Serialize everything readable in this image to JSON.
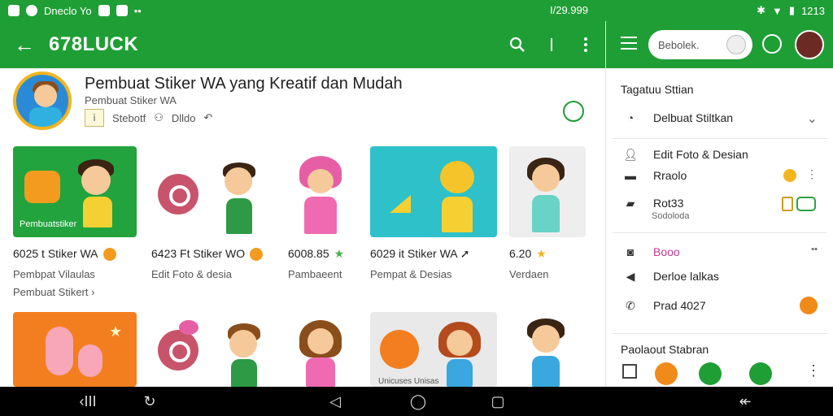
{
  "status_bar": {
    "left_text": "Dneclo Yo",
    "mid_text": "I/29.999",
    "time": "1213"
  },
  "app_bar": {
    "title": "678LUCK"
  },
  "app_info": {
    "title": "Pembuat Stiker WA yang Kreatif dan Mudah",
    "subtitle": "Pembuat Stiker  WA",
    "meta_1": "Stebotf",
    "meta_2": "Dlldo"
  },
  "grid": {
    "row1": [
      {
        "thumb_text": "Pembuatstiker",
        "title": "6025 t Stiker WA",
        "sub1": "Pembpat Vilaulas",
        "sub2": "Pembuat Stikert"
      },
      {
        "title": "6423 Ft Stiker WO",
        "sub1": "Edit Foto & desia"
      },
      {
        "title": "6008.85",
        "sub1": "Pambaeent"
      },
      {
        "title": "6029 it Stiker WA",
        "sub1": "Pempat & Desias"
      },
      {
        "title": "6.20",
        "sub1": "Verdaen"
      }
    ],
    "row2": [
      {
        "thumb_text": "",
        "title": ""
      },
      {
        "thumb_text": "",
        "title": ""
      },
      {
        "thumb_text": "",
        "title": ""
      },
      {
        "thumb_text": "Unicuses Unisas",
        "title": ""
      },
      {
        "thumb_text": "",
        "title": ""
      }
    ]
  },
  "drawer": {
    "search_text": "Bebolek.",
    "section_title": "Tagatuu Sttian",
    "dropdown_label": "Delbuat Stiltkan",
    "items": [
      {
        "label": "Edit Foto & Desian",
        "icon": "person-icon"
      },
      {
        "label": "Rraolo",
        "icon": "card-icon"
      },
      {
        "label": "Rot33",
        "sub": "Sodoloda",
        "icon": "folder-icon"
      },
      {
        "label": "Booo",
        "icon": "camera-icon"
      },
      {
        "label": "Derloe lalkas",
        "icon": "send-icon"
      },
      {
        "label": "Prad 4027",
        "icon": "phone-icon"
      }
    ],
    "bottom_label": "Paolaout Stabran"
  },
  "colors": {
    "primary": "#1f9e35",
    "accent": "#f39b1f",
    "nav": "#000000"
  }
}
